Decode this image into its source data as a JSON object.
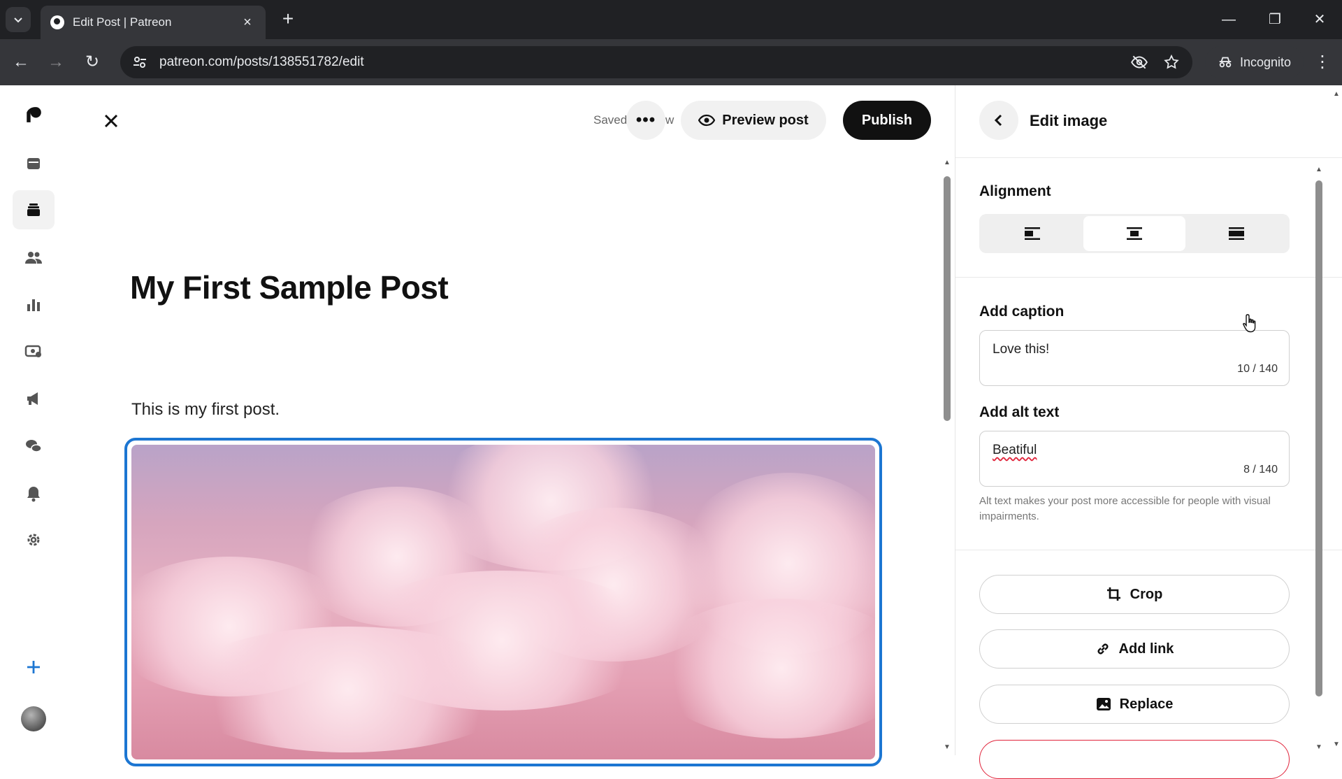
{
  "browser": {
    "tab_title": "Edit Post | Patreon",
    "url": "patreon.com/posts/138551782/edit",
    "incognito_label": "Incognito"
  },
  "rail": {
    "items": [
      "patreon-logo-icon",
      "library-icon",
      "posts-icon",
      "audience-icon",
      "insights-icon",
      "payouts-icon",
      "promotions-icon",
      "chats-icon",
      "notifications-icon",
      "settings-icon",
      "add-icon"
    ]
  },
  "editor": {
    "saved_status": "Saved just now",
    "preview_label": "Preview post",
    "publish_label": "Publish",
    "post_title": "My First Sample Post",
    "post_body": "This is my first post."
  },
  "panel": {
    "title": "Edit image",
    "alignment_label": "Alignment",
    "alignment_options": [
      "align-left",
      "align-center",
      "align-full"
    ],
    "alignment_selected": "align-center",
    "caption_label": "Add caption",
    "caption_value": "Love this!",
    "caption_count": "10 / 140",
    "alt_label": "Add alt text",
    "alt_value": "Beatiful",
    "alt_count": "8 / 140",
    "alt_help": "Alt text makes your post more accessible for people with visual impairments.",
    "crop_label": "Crop",
    "add_link_label": "Add link",
    "replace_label": "Replace"
  },
  "colors": {
    "accent": "#1c76d2",
    "publish_bg": "#111111",
    "danger": "#e0243b"
  }
}
